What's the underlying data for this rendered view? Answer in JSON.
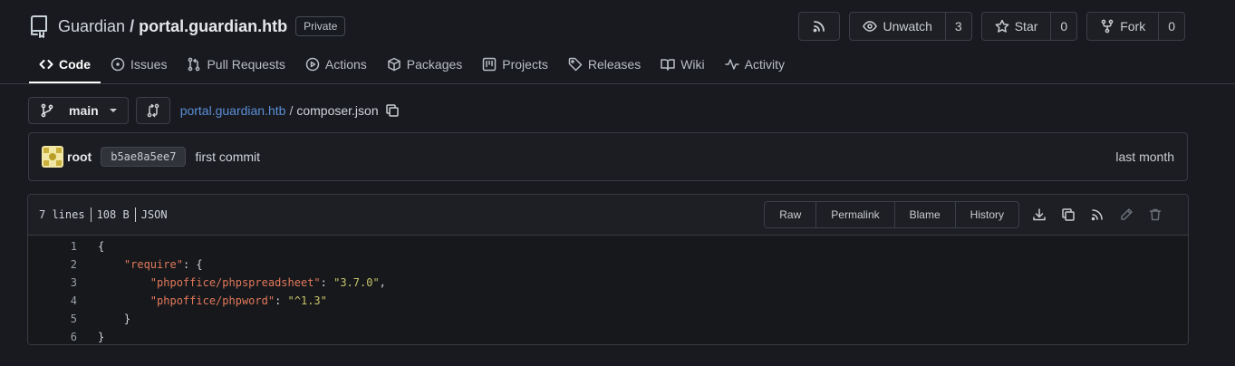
{
  "repo": {
    "owner": "Guardian",
    "separator": "/",
    "name": "portal.guardian.htb",
    "visibility": "Private"
  },
  "actions": {
    "unwatch_label": "Unwatch",
    "watch_count": "3",
    "star_label": "Star",
    "star_count": "0",
    "fork_label": "Fork",
    "fork_count": "0"
  },
  "tabs": [
    {
      "label": "Code",
      "icon": "code-icon",
      "active": true
    },
    {
      "label": "Issues",
      "icon": "issue-icon"
    },
    {
      "label": "Pull Requests",
      "icon": "pull-request-icon"
    },
    {
      "label": "Actions",
      "icon": "play-icon"
    },
    {
      "label": "Packages",
      "icon": "package-icon"
    },
    {
      "label": "Projects",
      "icon": "project-icon"
    },
    {
      "label": "Releases",
      "icon": "tag-icon"
    },
    {
      "label": "Wiki",
      "icon": "book-icon"
    },
    {
      "label": "Activity",
      "icon": "pulse-icon"
    }
  ],
  "branch": {
    "name": "main"
  },
  "breadcrumb": {
    "repo_link": "portal.guardian.htb",
    "separator": "/",
    "file": "composer.json"
  },
  "commit": {
    "author": "root",
    "sha": "b5ae8a5ee7",
    "message": "first commit",
    "time": "last month"
  },
  "file": {
    "lines": "7 lines",
    "size": "108 B",
    "language": "JSON",
    "buttons": {
      "raw": "Raw",
      "permalink": "Permalink",
      "blame": "Blame",
      "history": "History"
    }
  },
  "code": {
    "l1": "{",
    "l2_indent": "    ",
    "l2_key": "\"require\"",
    "l2_rest": ": {",
    "l3_indent": "        ",
    "l3_key": "\"phpoffice/phpspreadsheet\"",
    "l3_sep": ": ",
    "l3_val": "\"3.7.0\"",
    "l3_end": ",",
    "l4_indent": "        ",
    "l4_key": "\"phpoffice/phpword\"",
    "l4_sep": ": ",
    "l4_val": "\"^1.3\"",
    "l5": "    }",
    "l6": "}",
    "numbers": [
      "1",
      "2",
      "3",
      "4",
      "5",
      "6"
    ]
  },
  "colors": {
    "background": "#181a1f",
    "link": "#5b8ed6",
    "json_key": "#e2785a",
    "json_string": "#c9c36a"
  }
}
